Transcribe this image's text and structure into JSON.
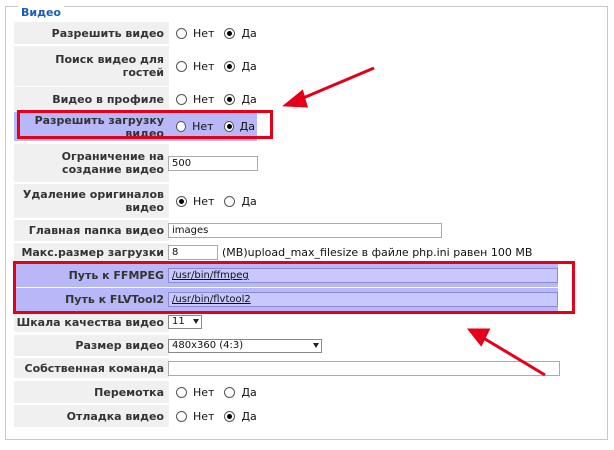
{
  "section_title": "Видео",
  "options": {
    "no": "Нет",
    "yes": "Да"
  },
  "rows": [
    {
      "label": "Разрешить видео",
      "type": "radio",
      "selected": "yes"
    },
    {
      "label": "Поиск видео для гостей",
      "type": "radio",
      "selected": "yes"
    },
    {
      "label": "Видео в профиле",
      "type": "radio",
      "selected": "yes"
    },
    {
      "label": "Разрешить загрузку видео",
      "type": "radio",
      "selected": "yes"
    },
    {
      "label": "Ограничение на создание видео",
      "type": "text",
      "value": "500"
    },
    {
      "label": "Удаление оригиналов видео",
      "type": "radio",
      "selected": "no"
    },
    {
      "label": "Главная папка видео",
      "type": "text",
      "value": "images"
    },
    {
      "label": "Макс.размер загрузки",
      "type": "text",
      "value": "8",
      "suffix": "(MB)upload_max_filesize в файле php.ini равен 100 MB"
    },
    {
      "label": "Путь к FFMPEG",
      "type": "text",
      "value": "/usr/bin/ffmpeg"
    },
    {
      "label": "Путь к FLVTool2",
      "type": "text",
      "value": "/usr/bin/flvtool2"
    },
    {
      "label": "Шкала качества видео",
      "type": "select",
      "value": "11"
    },
    {
      "label": "Размер видео",
      "type": "select",
      "value": "480x360 (4:3)"
    },
    {
      "label": "Собственная команда",
      "type": "text",
      "value": ""
    },
    {
      "label": "Перемотка",
      "type": "radio",
      "selected": "none"
    },
    {
      "label": "Отладка видео",
      "type": "radio",
      "selected": "yes"
    }
  ],
  "colors": {
    "highlight": "#b8b8f8",
    "annotation": "#e4001b",
    "legend": "#1a5fb4"
  }
}
